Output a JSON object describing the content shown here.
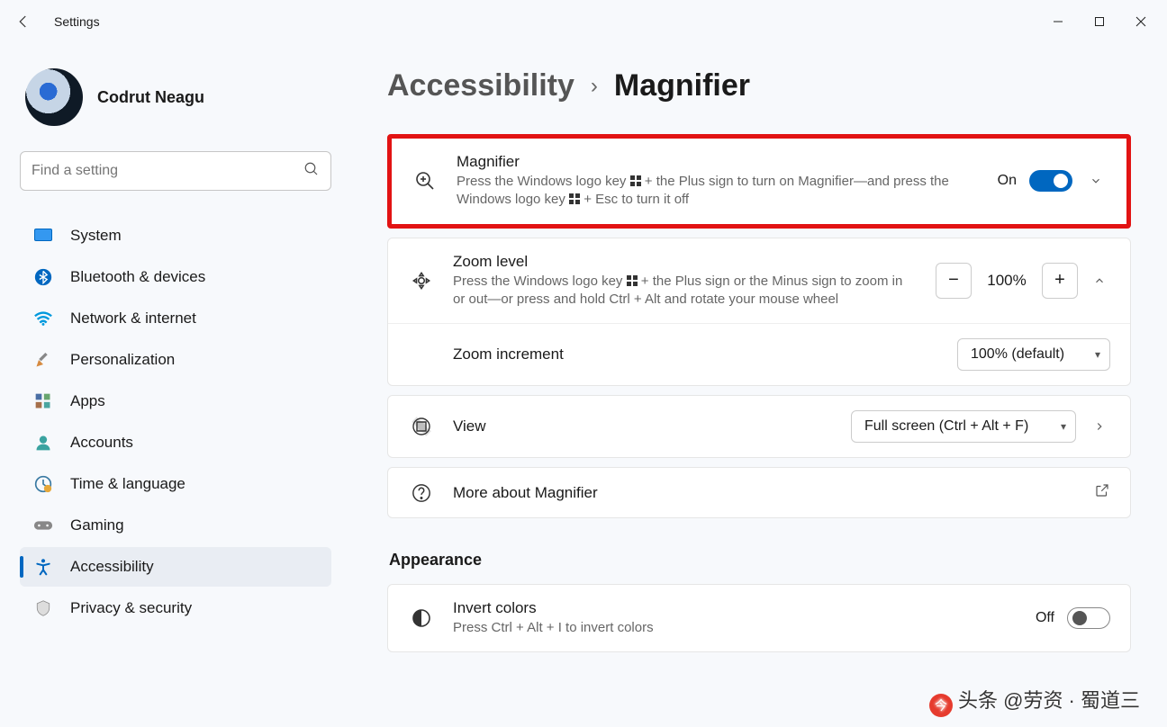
{
  "window": {
    "app_title": "Settings"
  },
  "user": {
    "name": "Codrut Neagu",
    "email": " "
  },
  "search": {
    "placeholder": "Find a setting"
  },
  "sidebar": {
    "items": [
      {
        "label": "System",
        "icon": "system-icon"
      },
      {
        "label": "Bluetooth & devices",
        "icon": "bluetooth-icon"
      },
      {
        "label": "Network & internet",
        "icon": "wifi-icon"
      },
      {
        "label": "Personalization",
        "icon": "personalization-icon"
      },
      {
        "label": "Apps",
        "icon": "apps-icon"
      },
      {
        "label": "Accounts",
        "icon": "accounts-icon"
      },
      {
        "label": "Time & language",
        "icon": "time-language-icon"
      },
      {
        "label": "Gaming",
        "icon": "gaming-icon"
      },
      {
        "label": "Accessibility",
        "icon": "accessibility-icon",
        "active": true
      },
      {
        "label": "Privacy & security",
        "icon": "privacy-icon"
      }
    ]
  },
  "breadcrumb": {
    "parent": "Accessibility",
    "current": "Magnifier"
  },
  "magnifier_card": {
    "title": "Magnifier",
    "desc_part1": "Press the Windows logo key ",
    "desc_part2": " + the Plus sign to turn on Magnifier—and press the Windows logo key ",
    "desc_part3": " + Esc to turn it off",
    "state": "On"
  },
  "zoom_card": {
    "title": "Zoom level",
    "desc_part1": "Press the Windows logo key ",
    "desc_part2": " + the Plus sign or the Minus sign to zoom in or out—or press and hold Ctrl + Alt and rotate your mouse wheel",
    "value": "100%",
    "increment_label": "Zoom increment",
    "increment_value": "100% (default)"
  },
  "view_card": {
    "title": "View",
    "value": "Full screen (Ctrl + Alt + F)"
  },
  "more_card": {
    "title": "More about Magnifier"
  },
  "appearance": {
    "section_title": "Appearance",
    "invert_title": "Invert colors",
    "invert_desc": "Press Ctrl + Alt + I to invert colors",
    "invert_state": "Off"
  },
  "watermark": "头条 @劳资 · 蜀道三"
}
